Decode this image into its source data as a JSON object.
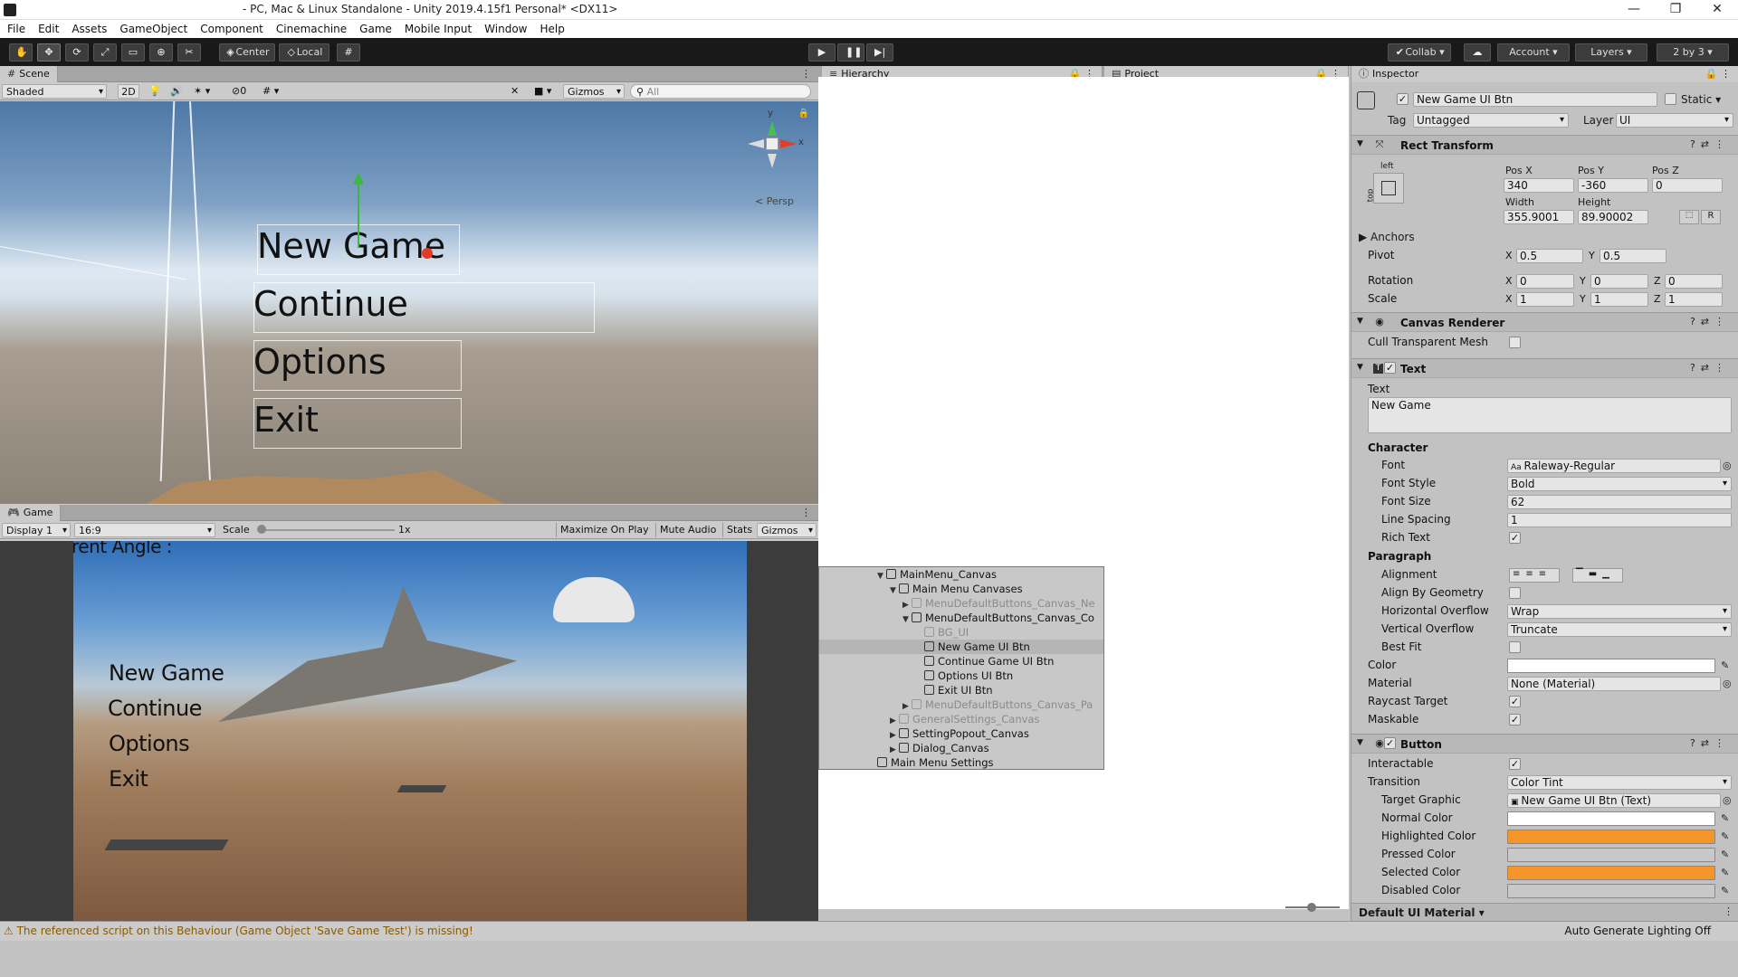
{
  "window": {
    "title": "- PC, Mac & Linux Standalone - Unity 2019.4.15f1 Personal* <DX11>",
    "minimize": "—",
    "maximize": "❐",
    "close": "✕"
  },
  "menu": [
    "File",
    "Edit",
    "Assets",
    "GameObject",
    "Component",
    "Cinemachine",
    "Game",
    "Mobile Input",
    "Window",
    "Help"
  ],
  "toolbar": {
    "pivot_center": "Center",
    "pivot_local": "Local",
    "collab": "Collab",
    "account": "Account",
    "layers": "Layers",
    "layout": "2 by 3"
  },
  "scene": {
    "tab": "Scene",
    "shading": "Shaded",
    "mode_2d": "2D",
    "hidden_count": "0",
    "gizmos": "Gizmos",
    "search_placeholder": "All",
    "persp": "< Persp",
    "axis_y": "y",
    "axis_x": "x",
    "menu_items": [
      "New Game",
      "Continue",
      "Options",
      "Exit"
    ]
  },
  "game": {
    "tab": "Game",
    "display": "Display 1",
    "aspect": "16:9",
    "scale_label": "Scale",
    "scale_value": "1x",
    "maximize": "Maximize On Play",
    "mute": "Mute Audio",
    "stats": "Stats",
    "gizmos": "Gizmos",
    "top_text": "rent Angle :",
    "menu_items": [
      "New Game",
      "Continue",
      "Options",
      "Exit"
    ]
  },
  "hierarchy": {
    "tab": "Hierarchy",
    "project_tab": "Project",
    "rows": [
      {
        "label": "MainMenu_Canvas",
        "indent": 1,
        "arrow": "▼",
        "state": "normal"
      },
      {
        "label": "Main Menu Canvases",
        "indent": 2,
        "arrow": "▼",
        "state": "normal"
      },
      {
        "label": "MenuDefaultButtons_Canvas_Ne",
        "indent": 3,
        "arrow": "▶",
        "state": "disabled"
      },
      {
        "label": "MenuDefaultButtons_Canvas_Co",
        "indent": 3,
        "arrow": "▼",
        "state": "normal"
      },
      {
        "label": "BG_UI",
        "indent": 4,
        "arrow": "",
        "state": "disabled"
      },
      {
        "label": "New Game UI Btn",
        "indent": 4,
        "arrow": "",
        "state": "selected"
      },
      {
        "label": "Continue Game UI Btn",
        "indent": 4,
        "arrow": "",
        "state": "normal"
      },
      {
        "label": "Options UI Btn",
        "indent": 4,
        "arrow": "",
        "state": "normal"
      },
      {
        "label": "Exit UI Btn",
        "indent": 4,
        "arrow": "",
        "state": "normal"
      },
      {
        "label": "MenuDefaultButtons_Canvas_Pa",
        "indent": 3,
        "arrow": "▶",
        "state": "disabled"
      },
      {
        "label": "GeneralSettings_Canvas",
        "indent": 2,
        "arrow": "▶",
        "state": "disabled"
      },
      {
        "label": "SettingPopout_Canvas",
        "indent": 2,
        "arrow": "▶",
        "state": "normal"
      },
      {
        "label": "Dialog_Canvas",
        "indent": 2,
        "arrow": "▶",
        "state": "normal"
      },
      {
        "label": "Main Menu Settings",
        "indent": 1,
        "arrow": "",
        "state": "normal"
      }
    ]
  },
  "inspector": {
    "tab": "Inspector",
    "object_name": "New Game UI Btn",
    "static_label": "Static",
    "tag_label": "Tag",
    "tag_value": "Untagged",
    "layer_label": "Layer",
    "layer_value": "UI",
    "rect_transform": {
      "title": "Rect Transform",
      "anchor_h": "left",
      "anchor_v": "top",
      "pos_x_label": "Pos X",
      "pos_x": "340",
      "pos_y_label": "Pos Y",
      "pos_y": "-360",
      "pos_z_label": "Pos Z",
      "pos_z": "0",
      "width_label": "Width",
      "width": "355.9001",
      "height_label": "Height",
      "height": "89.90002",
      "r_btn": "R",
      "anchors_label": "Anchors",
      "pivot_label": "Pivot",
      "pivot_x": "0.5",
      "pivot_y": "0.5",
      "rotation_label": "Rotation",
      "rot_x": "0",
      "rot_y": "0",
      "rot_z": "0",
      "scale_label": "Scale",
      "scale_x": "1",
      "scale_y": "1",
      "scale_z": "1"
    },
    "canvas_renderer": {
      "title": "Canvas Renderer",
      "cull_label": "Cull Transparent Mesh"
    },
    "text": {
      "title": "Text",
      "text_label": "Text",
      "text_value": "New Game",
      "character": "Character",
      "font_label": "Font",
      "font_value": "Raleway-Regular",
      "font_style_label": "Font Style",
      "font_style_value": "Bold",
      "font_size_label": "Font Size",
      "font_size_value": "62",
      "line_spacing_label": "Line Spacing",
      "line_spacing_value": "1",
      "rich_text_label": "Rich Text",
      "paragraph": "Paragraph",
      "alignment_label": "Alignment",
      "align_geom_label": "Align By Geometry",
      "h_overflow_label": "Horizontal Overflow",
      "h_overflow_value": "Wrap",
      "v_overflow_label": "Vertical Overflow",
      "v_overflow_value": "Truncate",
      "best_fit_label": "Best Fit",
      "color_label": "Color",
      "material_label": "Material",
      "material_value": "None (Material)",
      "raycast_label": "Raycast Target",
      "maskable_label": "Maskable"
    },
    "button": {
      "title": "Button",
      "interactable_label": "Interactable",
      "transition_label": "Transition",
      "transition_value": "Color Tint",
      "target_label": "Target Graphic",
      "target_value": "New Game UI Btn (Text)",
      "normal_label": "Normal Color",
      "highlighted_label": "Highlighted Color",
      "pressed_label": "Pressed Color",
      "selected_label": "Selected Color",
      "disabled_label": "Disabled Color"
    },
    "footer_material": "Default UI Material"
  },
  "colors": {
    "normal": "#ffffff",
    "highlighted": "#f5962a",
    "pressed": "#c8c8c8",
    "selected": "#f5962a",
    "disabled": "#c8c8c8",
    "text_color": "#ffffff"
  },
  "status": {
    "warning": "The referenced script on this Behaviour (Game Object 'Save Game Test') is missing!",
    "lighting": "Auto Generate Lighting Off"
  }
}
